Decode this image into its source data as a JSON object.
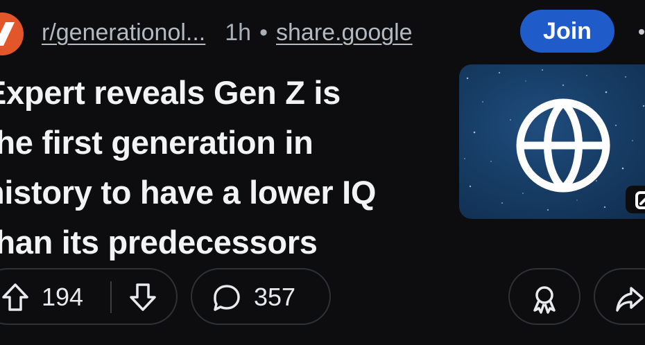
{
  "header": {
    "subreddit": "r/generationol...",
    "age": "1h",
    "separator": "•",
    "domain": "share.google",
    "join_label": "Join",
    "subreddit_icon": "subreddit-avatar-icon",
    "overflow_icon": "more-options-icon"
  },
  "post": {
    "title_lines": [
      "Expert reveals Gen Z is",
      "the first generation in",
      "history to have a lower IQ",
      "than its predecessors"
    ],
    "thumbnail_icon": "globe-icon",
    "external_badge_icon": "external-link-icon"
  },
  "actions": {
    "upvote_count": "194",
    "comment_count": "357",
    "upvote_icon": "upvote-arrow-icon",
    "downvote_icon": "downvote-arrow-icon",
    "comment_icon": "comment-bubble-icon",
    "award_icon": "award-ribbon-icon",
    "share_icon": "share-arrow-icon"
  },
  "colors": {
    "background": "#0d0d0f",
    "join_button": "#1f5cc9",
    "subreddit_icon_bg": "#e2562a",
    "thumbnail_bg": "#173d66",
    "pill_border": "#2e3236",
    "text_primary": "#f2f3f5",
    "text_secondary": "#a9b0b7"
  }
}
